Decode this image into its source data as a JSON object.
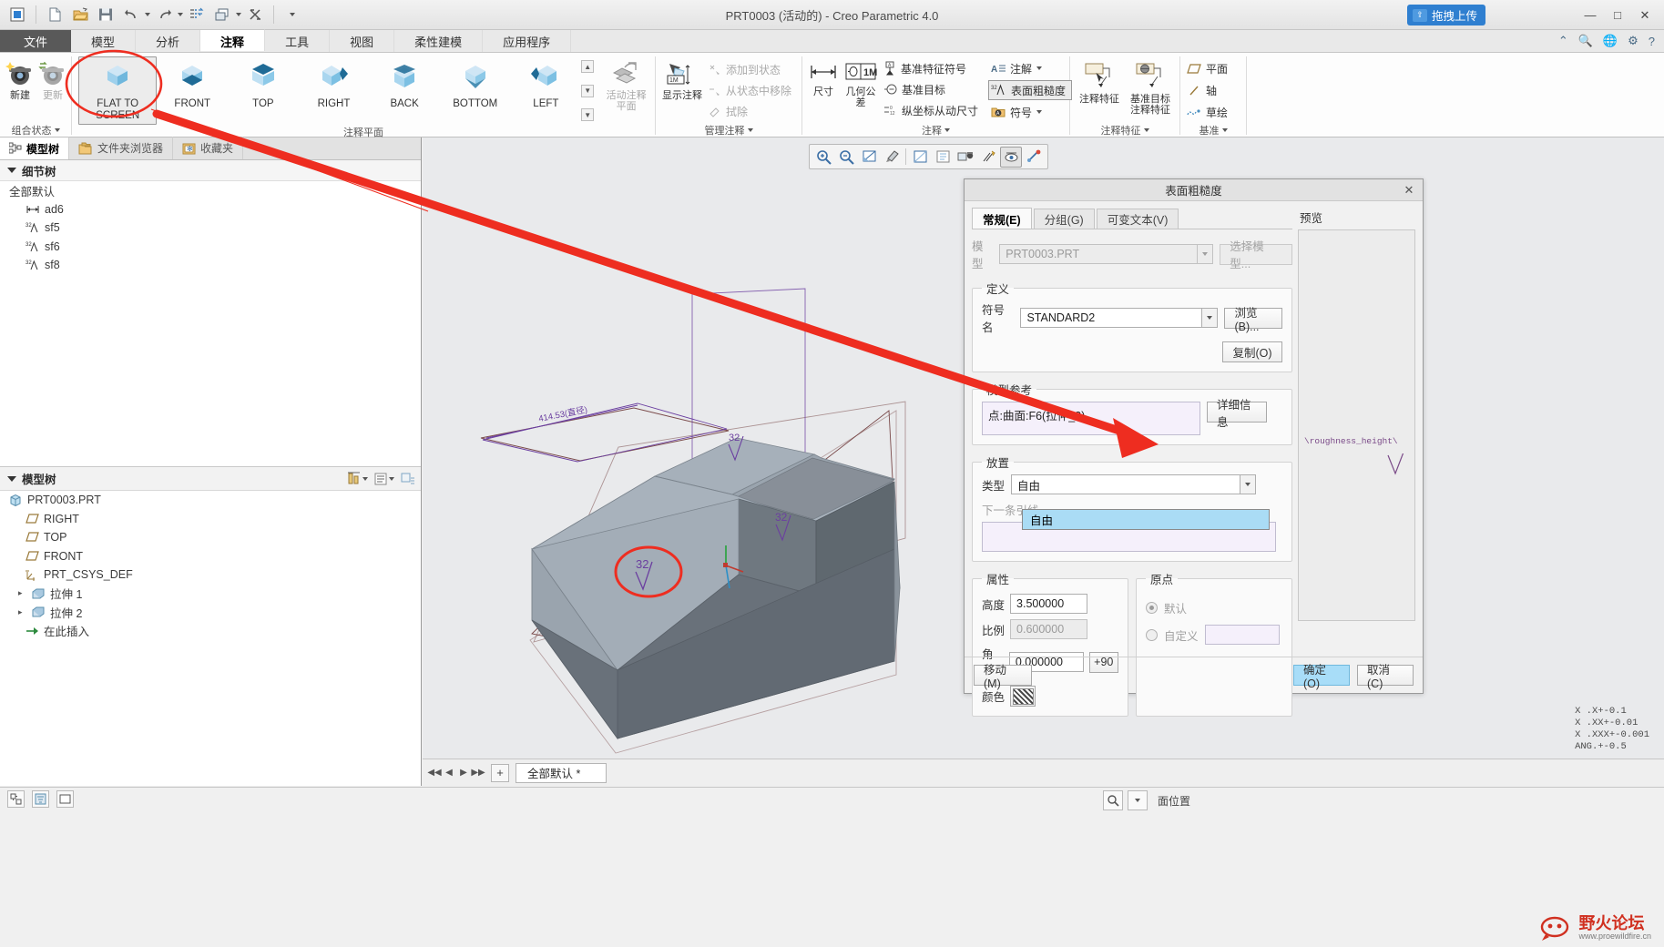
{
  "window": {
    "title": "PRT0003 (活动的) - Creo Parametric 4.0",
    "drag_upload": "拖拽上传",
    "minimize": "—",
    "maximize": "□",
    "close": "✕"
  },
  "quick_access": [
    {
      "name": "app-menu-icon",
      "glyph": "▣"
    },
    {
      "name": "new-file-icon",
      "glyph": "🗋"
    },
    {
      "name": "open-folder-icon",
      "glyph": "📂"
    },
    {
      "name": "save-icon",
      "glyph": "💾"
    },
    {
      "name": "undo-icon",
      "glyph": "↶"
    },
    {
      "name": "redo-icon",
      "glyph": "↷"
    },
    {
      "name": "regenerate-icon",
      "glyph": "⁘"
    },
    {
      "name": "window-icon",
      "glyph": "❐"
    },
    {
      "name": "close-window-icon",
      "glyph": "⌦"
    },
    {
      "name": "qat-more-icon",
      "glyph": "▾"
    }
  ],
  "ribbon_tabs": [
    {
      "label": "文件",
      "kind": "file"
    },
    {
      "label": "模型",
      "kind": "normal"
    },
    {
      "label": "分析",
      "kind": "normal"
    },
    {
      "label": "注释",
      "kind": "active"
    },
    {
      "label": "工具",
      "kind": "normal"
    },
    {
      "label": "视图",
      "kind": "normal"
    },
    {
      "label": "柔性建模",
      "kind": "normal"
    },
    {
      "label": "应用程序",
      "kind": "normal"
    }
  ],
  "ribbon": {
    "group_combine_state": {
      "label": "组合状态",
      "buttons": [
        {
          "label": "新建",
          "icon": "new-camera-icon",
          "disabled": false
        },
        {
          "label": "更新",
          "icon": "update-camera-icon",
          "disabled": true
        }
      ]
    },
    "group_annotation_plane": {
      "label": "注释平面",
      "views": [
        {
          "label": "FLAT TO\nSCREEN",
          "line1": "FLAT TO",
          "line2": "SCREEN",
          "selected": true
        },
        {
          "label": "FRONT",
          "selected": false
        },
        {
          "label": "TOP",
          "selected": false
        },
        {
          "label": "RIGHT",
          "selected": false
        },
        {
          "label": "BACK",
          "selected": false
        },
        {
          "label": "BOTTOM",
          "selected": false
        },
        {
          "label": "LEFT",
          "selected": false
        }
      ],
      "scroll_up": "▲",
      "scroll_down": "▼",
      "scroll_more": "▼",
      "active_annotation_plane": "活动注释\n平面",
      "active_annotation_plane_l1": "活动注释",
      "active_annotation_plane_l2": "平面"
    },
    "group_manage_annotations": {
      "label": "管理注释",
      "show_annotation": "显示注释",
      "items": [
        {
          "label": "添加到状态",
          "disabled": true
        },
        {
          "label": "从状态中移除",
          "disabled": true
        },
        {
          "label": "拭除",
          "disabled": true
        }
      ]
    },
    "group_annotations": {
      "label": "注释",
      "big": [
        {
          "label": "尺寸"
        },
        {
          "label": "几何公差"
        }
      ],
      "small_col1": [
        {
          "label": "基准特征符号",
          "icon": "datum-feature-icon"
        },
        {
          "label": "基准目标",
          "icon": "datum-target-icon"
        },
        {
          "label": "纵坐标从动尺寸",
          "icon": "ordinate-dim-icon"
        }
      ],
      "small_col2": [
        {
          "label": "注解",
          "icon": "note-icon",
          "dropdown": true,
          "boxed": false
        },
        {
          "label": "表面粗糙度",
          "icon": "surface-finish-icon",
          "dropdown": false,
          "boxed": true
        },
        {
          "label": "符号",
          "icon": "symbol-icon",
          "dropdown": true,
          "boxed": false
        }
      ]
    },
    "group_annotation_features": {
      "label": "注释特征",
      "items": [
        {
          "l1": "注释特征",
          "l2": ""
        },
        {
          "l1": "基准目标",
          "l2": "注释特征"
        }
      ]
    },
    "group_datum": {
      "label": "基准",
      "items": [
        {
          "label": "平面",
          "icon": "plane-icon"
        },
        {
          "label": "轴",
          "icon": "axis-icon"
        },
        {
          "label": "草绘",
          "icon": "sketch-icon"
        }
      ]
    },
    "right_icons": [
      "collapse-ribbon-icon",
      "search-icon",
      "globe-icon",
      "settings-icon",
      "help-icon"
    ]
  },
  "left_panel": {
    "tabs": [
      {
        "label": "模型树",
        "icon": "model-tree-icon",
        "active": true
      },
      {
        "label": "文件夹浏览器",
        "icon": "folder-browser-icon",
        "active": false
      },
      {
        "label": "收藏夹",
        "icon": "favorites-icon",
        "active": false
      }
    ],
    "detail_tree": {
      "title": "细节树",
      "root": "全部默认",
      "items": [
        {
          "label": "ad6",
          "icon": "dimension-icon"
        },
        {
          "label": "sf5",
          "icon": "surface-finish-icon"
        },
        {
          "label": "sf6",
          "icon": "surface-finish-icon"
        },
        {
          "label": "sf8",
          "icon": "surface-finish-icon"
        }
      ]
    },
    "model_tree": {
      "title": "模型树",
      "tools": [
        "filter-icon",
        "settings-icon",
        "display-icon"
      ],
      "items": [
        {
          "label": "PRT0003.PRT",
          "icon": "part-icon",
          "indent": 0,
          "expander": ""
        },
        {
          "label": "RIGHT",
          "icon": "plane-icon",
          "indent": 1,
          "expander": ""
        },
        {
          "label": "TOP",
          "icon": "plane-icon",
          "indent": 1,
          "expander": ""
        },
        {
          "label": "FRONT",
          "icon": "plane-icon",
          "indent": 1,
          "expander": ""
        },
        {
          "label": "PRT_CSYS_DEF",
          "icon": "csys-icon",
          "indent": 1,
          "expander": ""
        },
        {
          "label": "拉伸 1",
          "icon": "extrude-icon",
          "indent": 1,
          "expander": "▸"
        },
        {
          "label": "拉伸 2",
          "icon": "extrude-icon",
          "indent": 1,
          "expander": "▸"
        },
        {
          "label": "在此插入",
          "icon": "insert-here-icon",
          "indent": 1,
          "expander": ""
        }
      ]
    }
  },
  "graphics": {
    "toolbar_icons": [
      "zoom-in-icon",
      "zoom-out-icon",
      "refit-icon",
      "repaint-icon",
      "display-style-icon",
      "saved-views-icon",
      "view-manager-icon",
      "appearance-icon",
      "annotation-display-icon",
      "datum-display-icon",
      "spin-center-icon"
    ],
    "dimension_label": "414.53(直径)",
    "surface_finish_values": [
      "32",
      "32",
      "32"
    ],
    "bottom": {
      "nav_first": "◀◀",
      "nav_prev": "◀",
      "nav_next": "▶",
      "nav_last": "▶▶",
      "add": "+",
      "combo_state": "全部默认 *"
    }
  },
  "dialog": {
    "title": "表面粗糙度",
    "close": "✕",
    "tabs": [
      {
        "label": "常规(E)",
        "active": true
      },
      {
        "label": "分组(G)",
        "active": false
      },
      {
        "label": "可变文本(V)",
        "active": false
      }
    ],
    "model": {
      "label": "模型",
      "value": "PRT0003.PRT",
      "select_model_button": "选择模型..."
    },
    "definition": {
      "legend": "定义",
      "symbol_name_label": "符号名",
      "symbol_name_value": "STANDARD2",
      "browse_button": "浏览(B)...",
      "copy_button": "复制(O)"
    },
    "model_reference": {
      "legend": "模型参考",
      "value": "点:曲面:F6(拉伸_2)",
      "details_button": "详细信息"
    },
    "placement": {
      "legend": "放置",
      "type_label": "类型",
      "type_value": "自由",
      "type_options": [
        "自由"
      ],
      "next_leader_label": "下一条引线"
    },
    "properties": {
      "legend": "属性",
      "height_label": "高度",
      "height_value": "3.500000",
      "ratio_label": "比例",
      "ratio_value": "0.600000",
      "angle_label": "角度",
      "angle_value": "0.000000",
      "angle_plus90": "+90",
      "color_label": "颜色"
    },
    "origin": {
      "legend": "原点",
      "default_label": "默认",
      "custom_label": "自定义",
      "default_selected": true
    },
    "preview": {
      "label": "预览",
      "sample_text": "\\roughness_height\\"
    },
    "footer": {
      "move_button": "移动(M)",
      "ok_button": "确定(O)",
      "cancel_button": "取消(C)"
    }
  },
  "status_bar": {
    "icons": [
      "select-items-icon",
      "filter-icon",
      "layer-icon"
    ],
    "coordinate_lines": [
      "X .X+-0.1",
      "X .XX+-0.01",
      "X .XXX+-0.001",
      "ANG.+-0.5"
    ],
    "position_label": "面位置",
    "search_icon": "search-icon",
    "dropdown_icon": "▾"
  },
  "watermark": {
    "title": "野火论坛",
    "subtitle": "www.proewildfire.cn"
  },
  "colors": {
    "accent_blue": "#2f7fd0",
    "highlight": "#aadcf5",
    "annotation_red": "#f03020",
    "model_gray": "#97a0aa",
    "model_dark": "#5f6a75"
  }
}
